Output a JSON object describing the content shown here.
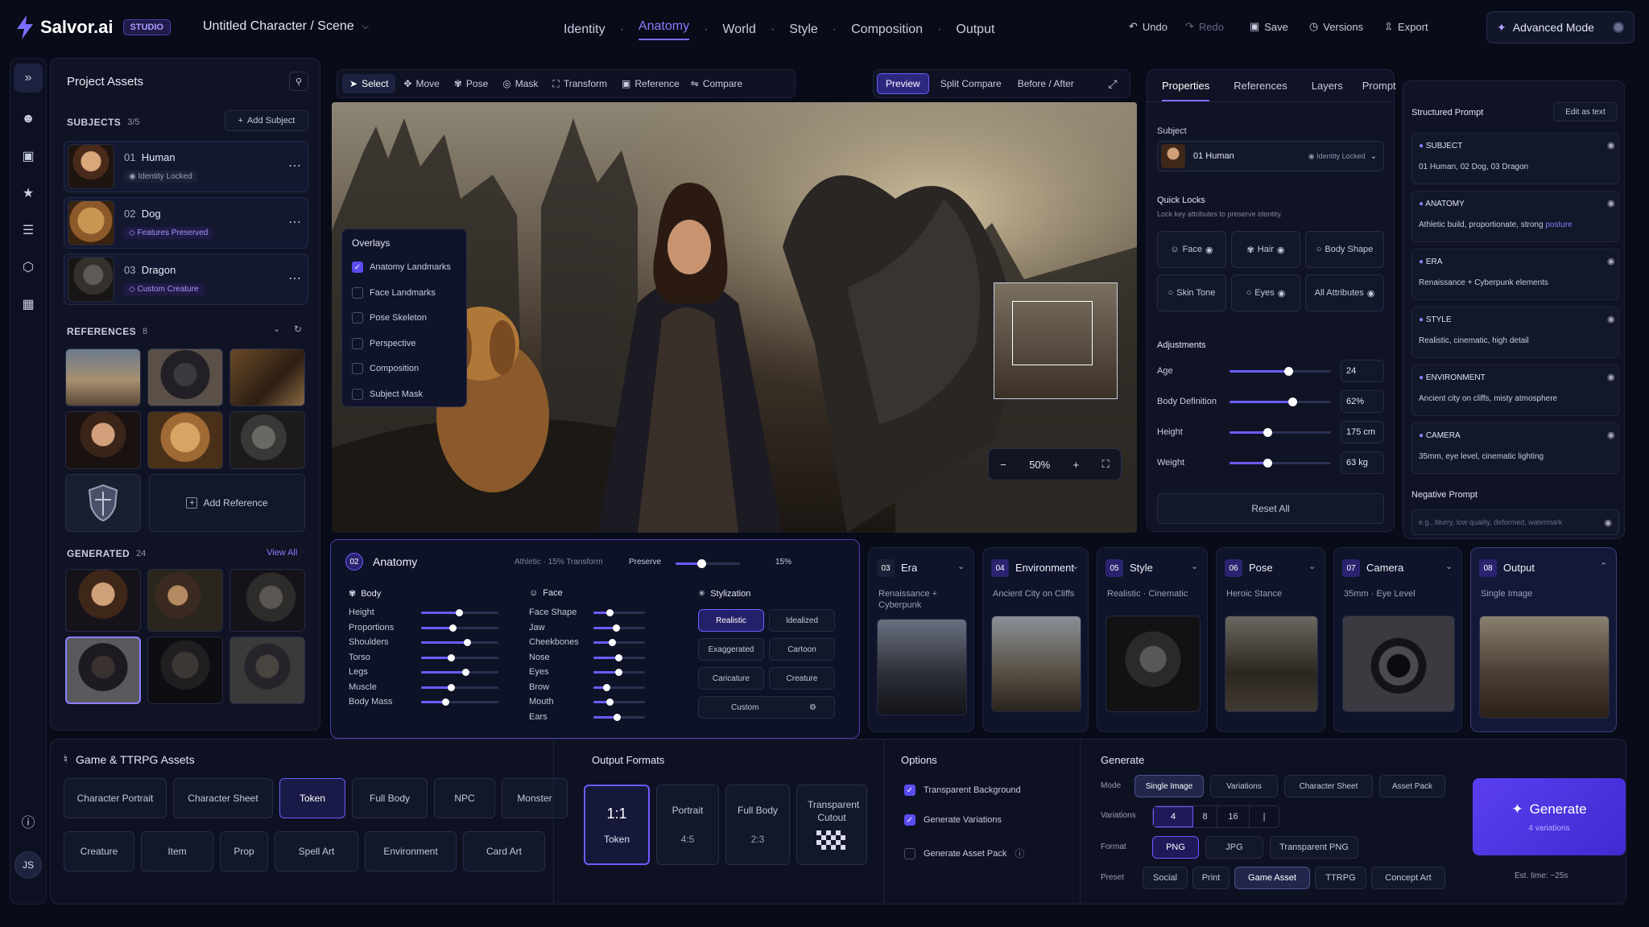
{
  "app": {
    "name": "Salvor.ai",
    "badge": "STUDIO",
    "project_title": "Untitled Character / Scene"
  },
  "top_nav": [
    "Identity",
    "Anatomy",
    "World",
    "Style",
    "Composition",
    "Output"
  ],
  "top_actions": {
    "undo": "Undo",
    "redo": "Redo",
    "save": "Save",
    "versions": "Versions",
    "export": "Export",
    "advanced": "Advanced Mode"
  },
  "user_initials": "JS",
  "assets": {
    "title": "Project Assets",
    "subjects_label": "SUBJECTS",
    "subjects_count": "3/5",
    "add_subject": "Add Subject",
    "subjects": [
      {
        "num": "01",
        "name": "Human",
        "tag": "Identity Locked"
      },
      {
        "num": "02",
        "name": "Dog",
        "tag": "Features Preserved"
      },
      {
        "num": "03",
        "name": "Dragon",
        "tag": "Custom Creature"
      }
    ],
    "references_label": "REFERENCES",
    "references_count": "8",
    "add_reference": "Add Reference",
    "generated_label": "GENERATED",
    "generated_count": "24",
    "view_all": "View All"
  },
  "toolbar": {
    "tools": [
      "Select",
      "Move",
      "Pose",
      "Mask",
      "Transform",
      "Reference",
      "Compare"
    ],
    "views": [
      "Preview",
      "Split Compare",
      "Before / After"
    ]
  },
  "overlays": {
    "title": "Overlays",
    "items": [
      {
        "label": "Anatomy Landmarks",
        "checked": true
      },
      {
        "label": "Face Landmarks",
        "checked": false
      },
      {
        "label": "Pose Skeleton",
        "checked": false
      },
      {
        "label": "Perspective",
        "checked": false
      },
      {
        "label": "Composition",
        "checked": false
      },
      {
        "label": "Subject Mask",
        "checked": false
      }
    ]
  },
  "zoom": "50%",
  "properties": {
    "tabs": [
      "Properties",
      "References",
      "Layers",
      "Prompt"
    ],
    "subject_label": "Subject",
    "subject_value": "01 Human",
    "subject_status": "Identity Locked",
    "quick_locks_title": "Quick Locks",
    "quick_locks_desc": "Lock key attributes to preserve identity.",
    "locks": [
      "Face",
      "Hair",
      "Body Shape",
      "Skin Tone",
      "Eyes",
      "All Attributes"
    ],
    "adjustments_title": "Adjustments",
    "adjustments": [
      {
        "label": "Age",
        "value": "24",
        "level": 0.58
      },
      {
        "label": "Body Definition",
        "value": "62%",
        "level": 0.62
      },
      {
        "label": "Height",
        "value": "175 cm",
        "level": 0.37
      },
      {
        "label": "Weight",
        "value": "63 kg",
        "level": 0.37
      }
    ],
    "reset": "Reset All"
  },
  "structured_prompt": {
    "title": "Structured Prompt",
    "edit": "Edit as text",
    "sections": [
      {
        "label": "SUBJECT",
        "value": "01 Human, 02 Dog, 03 Dragon",
        "link": ""
      },
      {
        "label": "ANATOMY",
        "value": "Athletic build, proportionate, strong ",
        "link": "posture"
      },
      {
        "label": "ERA",
        "value": "Renaissance + Cyberpunk elements",
        "link": ""
      },
      {
        "label": "STYLE",
        "value": "Realistic, cinematic, high detail",
        "link": ""
      },
      {
        "label": "ENVIRONMENT",
        "value": "Ancient city on cliffs, misty atmosphere",
        "link": ""
      },
      {
        "label": "CAMERA",
        "value": "35mm, eye level, cinematic lighting",
        "link": ""
      }
    ],
    "negative_title": "Negative Prompt",
    "negative_placeholder": "e.g., blurry, low quality, deformed, watermark"
  },
  "anatomy": {
    "num": "02",
    "title": "Anatomy",
    "summary": "Athletic · 15% Transform",
    "preserve_label": "Preserve",
    "preserve_value": "15%",
    "preserve_level": 0.15,
    "body_title": "Body",
    "body": [
      {
        "label": "Height",
        "level": 0.5
      },
      {
        "label": "Proportions",
        "level": 0.42
      },
      {
        "label": "Shoulders",
        "level": 0.6
      },
      {
        "label": "Torso",
        "level": 0.4
      },
      {
        "label": "Legs",
        "level": 0.58
      },
      {
        "label": "Muscle",
        "level": 0.4
      },
      {
        "label": "Body Mass",
        "level": 0.32
      }
    ],
    "face_title": "Face",
    "face": [
      {
        "label": "Face Shape",
        "level": 0.33
      },
      {
        "label": "Jaw",
        "level": 0.45
      },
      {
        "label": "Cheekbones",
        "level": 0.38
      },
      {
        "label": "Nose",
        "level": 0.5
      },
      {
        "label": "Eyes",
        "level": 0.5
      },
      {
        "label": "Brow",
        "level": 0.27
      },
      {
        "label": "Mouth",
        "level": 0.33
      },
      {
        "label": "Ears",
        "level": 0.47
      }
    ],
    "stylization_title": "Stylization",
    "styles": [
      "Realistic",
      "Idealized",
      "Exaggerated",
      "Cartoon",
      "Caricature",
      "Creature"
    ],
    "custom": "Custom"
  },
  "cards": [
    {
      "num": "03",
      "title": "Era",
      "sub": "Renaissance + Cyberpunk"
    },
    {
      "num": "04",
      "title": "Environment",
      "sub": "Ancient City on Cliffs"
    },
    {
      "num": "05",
      "title": "Style",
      "sub": "Realistic · Cinematic"
    },
    {
      "num": "06",
      "title": "Pose",
      "sub": "Heroic Stance"
    },
    {
      "num": "07",
      "title": "Camera",
      "sub": "35mm · Eye Level"
    },
    {
      "num": "08",
      "title": "Output",
      "sub": "Single Image"
    }
  ],
  "game_assets": {
    "title": "Game & TTRPG Assets",
    "row1": [
      "Character Portrait",
      "Character Sheet",
      "Token",
      "Full Body",
      "NPC",
      "Monster"
    ],
    "row2": [
      "Creature",
      "Item",
      "Prop",
      "Spell Art",
      "Environment",
      "Card Art"
    ]
  },
  "output_formats": {
    "title": "Output Formats",
    "items": [
      {
        "main": "1:1",
        "sub": "Token"
      },
      {
        "main": "Portrait",
        "sub": "4:5"
      },
      {
        "main": "Full Body",
        "sub": "2:3"
      },
      {
        "main": "Transparent Cutout",
        "sub": ""
      }
    ]
  },
  "options": {
    "title": "Options",
    "items": [
      {
        "label": "Transparent Background",
        "checked": true
      },
      {
        "label": "Generate Variations",
        "checked": true
      },
      {
        "label": "Generate Asset Pack",
        "checked": false
      }
    ]
  },
  "generate": {
    "title": "Generate",
    "mode_label": "Mode",
    "modes": [
      "Single Image",
      "Variations",
      "Character Sheet",
      "Asset Pack"
    ],
    "variations_label": "Variations",
    "variations": [
      "4",
      "8",
      "16"
    ],
    "format_label": "Format",
    "formats": [
      "PNG",
      "JPG",
      "Transparent PNG"
    ],
    "preset_label": "Preset",
    "presets": [
      "Social",
      "Print",
      "Game Asset",
      "TTRPG",
      "Concept Art"
    ],
    "button": "Generate",
    "button_sub": "4 variations",
    "est": "Est. time: ~25s"
  },
  "colors": {
    "accent": "#6c5cff",
    "bg": "#080b18",
    "panel": "#0f1324"
  }
}
